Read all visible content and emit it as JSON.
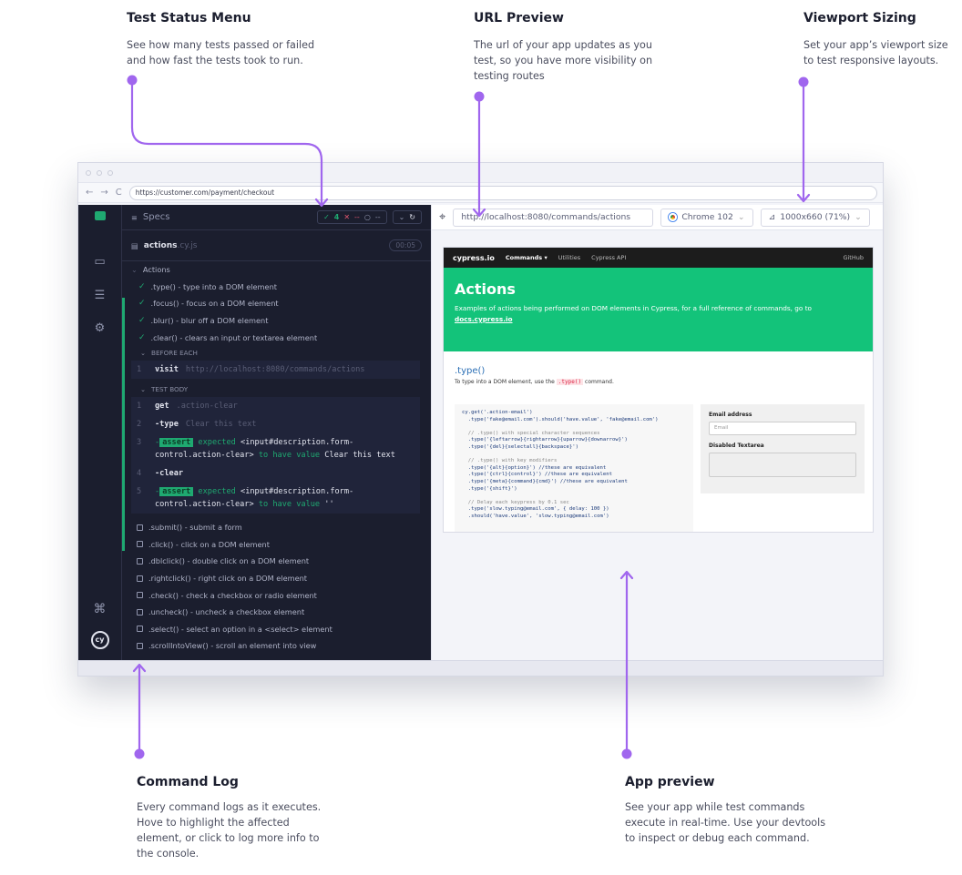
{
  "annotations": {
    "status_menu": {
      "title": "Test  Status Menu",
      "desc1": "See how many tests passed or failed",
      "desc2": "and how fast the tests took to run."
    },
    "url_preview": {
      "title": "URL Preview",
      "desc1": "The url of your app updates as you",
      "desc2": "test, so you have more visibility on",
      "desc3": "testing routes"
    },
    "viewport": {
      "title": "Viewport Sizing",
      "desc1": "Set your app’s viewport size",
      "desc2": "to test responsive layouts."
    },
    "command_log": {
      "title": "Command Log",
      "desc1": "Every command logs as it executes.",
      "desc2": "Hove to highlight the affected",
      "desc3": "element, or click to log more info to",
      "desc4": "the console."
    },
    "app_preview": {
      "title": "App preview",
      "desc1": "See your app while test commands",
      "desc2": "execute in real-time. Use your devtools",
      "desc3": "to inspect or debug each command."
    }
  },
  "browser": {
    "url": "https://customer.com/payment/checkout",
    "nav_back": "←",
    "nav_forward": "→",
    "nav_reload": "C"
  },
  "rail_icons": [
    "cypress-logo-icon",
    "specs-icon",
    "runs-icon",
    "settings-icon",
    "shortcuts-icon",
    "cy-logo-icon"
  ],
  "runner": {
    "specs_label": "Specs",
    "passed": "4",
    "failed": "--",
    "pending": "--",
    "spec_name": "actions",
    "spec_ext": ".cy.js",
    "duration": "00:05",
    "suite_title": "Actions",
    "passed_tests": [
      ".type() - type into a DOM element",
      ".focus() - focus on a DOM element",
      ".blur() - blur off a DOM element",
      ".clear() - clears an input or textarea element"
    ],
    "before_each_label": "BEFORE EACH",
    "before_each_cmd": {
      "num": "1",
      "name": "visit",
      "arg": "http://localhost:8080/commands/actions"
    },
    "test_body_label": "TEST BODY",
    "cmd1": {
      "num": "1",
      "name": "get",
      "arg": ".action-clear"
    },
    "cmd2": {
      "num": "2",
      "name": "-type",
      "arg": "Clear this text"
    },
    "cmd3": {
      "num": "3",
      "dash": "-",
      "chip": "assert",
      "text_a": "expected",
      "text_b": "<input#description.form-",
      "text_c": "control.action-clear>",
      "text_d": "to have value",
      "text_e": "Clear this text"
    },
    "cmd4": {
      "num": "4",
      "name": "-clear"
    },
    "cmd5": {
      "num": "5",
      "dash": "-",
      "chip": "assert",
      "text_a": "expected",
      "text_b": "<input#description.form-",
      "text_c": "control.action-clear>",
      "text_d": "to have value",
      "text_e": "''"
    },
    "pending_tests": [
      ".submit() - submit a form",
      ".click() - click on a DOM element",
      ".dblclick() - double click on a DOM element",
      ".rightclick() - right click on a DOM element",
      ".check() - check a checkbox or radio element",
      ".uncheck() - uncheck a checkbox element",
      ".select() - select an option in a <select> element",
      ".scrollIntoView() - scroll an element into view"
    ]
  },
  "preview_toolbar": {
    "url": "http://localhost:8080/commands/actions",
    "browser": "Chrome 102",
    "viewport": "1000x660 (71%)"
  },
  "app": {
    "brand": "cypress.io",
    "nav": [
      "Commands ▾",
      "Utilities",
      "Cypress API"
    ],
    "github": "GitHub",
    "hero_title": "Actions",
    "hero_desc": "Examples of actions being performed on DOM elements in Cypress, for a full reference of commands, go to",
    "hero_link": "docs.cypress.io",
    "section_title": ".type()",
    "section_desc_a": "To type into a DOM element, use the",
    "section_code": ".type()",
    "section_desc_b": "command.",
    "code_lines": [
      "cy.get('.action-email')",
      "  .type('fake@email.com').should('have.value', 'fake@email.com')",
      "",
      "  // .type() with special character sequences",
      "  .type('{leftarrow}{rightarrow}{uparrow}{downarrow}')",
      "  .type('{del}{selectall}{backspace}')",
      "",
      "  // .type() with key modifiers",
      "  .type('{alt}{option}') //these are equivalent",
      "  .type('{ctrl}{control}') //these are equivalent",
      "  .type('{meta}{command}{cmd}') //these are equivalent",
      "  .type('{shift}')",
      "",
      "  // Delay each keypress by 0.1 sec",
      "  .type('slow.typing@email.com', { delay: 100 })",
      "  .should('have.value', 'slow.typing@email.com')"
    ],
    "email_label": "Email address",
    "email_placeholder": "Email",
    "textarea_label": "Disabled Textarea"
  },
  "colors": {
    "accent": "#a066ee",
    "pass": "#1fa971",
    "fail": "#e45770",
    "runner_bg": "#1b1e2e",
    "hero": "#13c37a"
  }
}
